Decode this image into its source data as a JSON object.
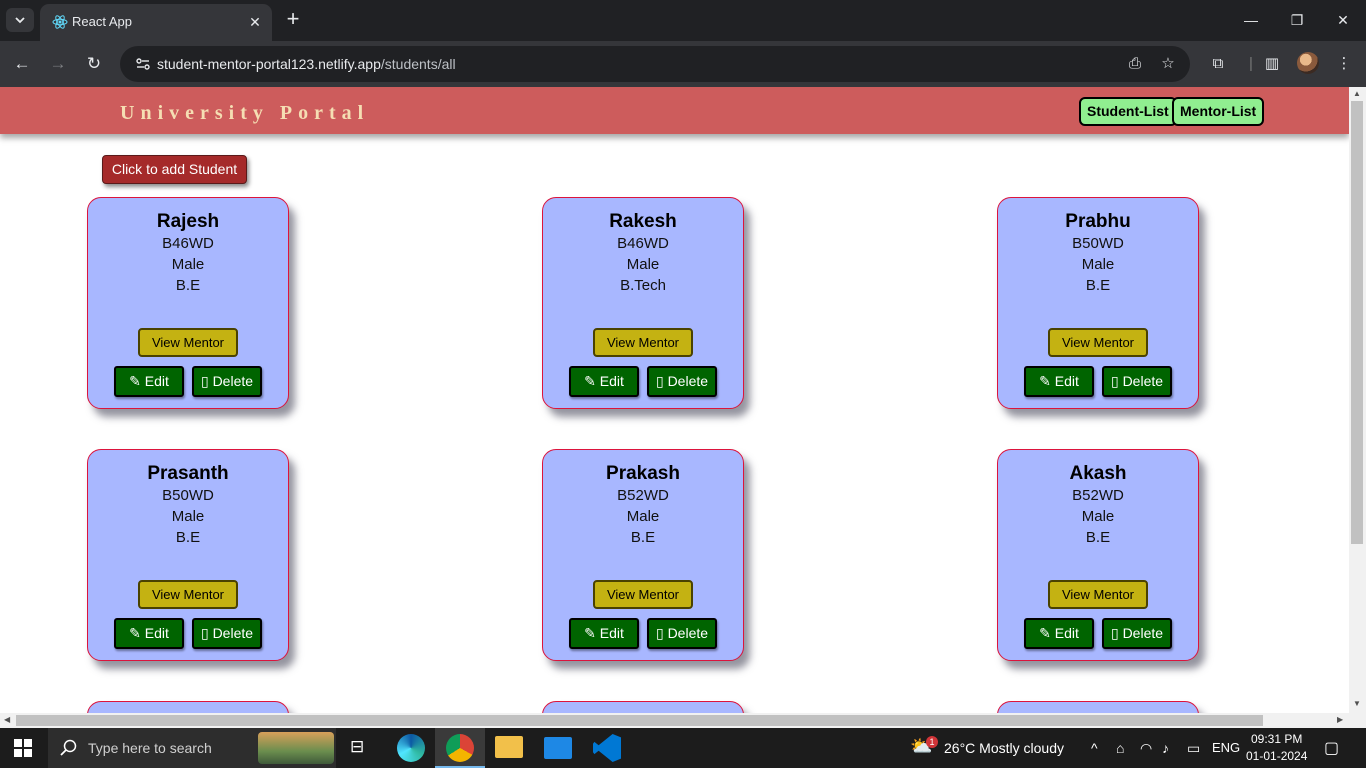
{
  "browser": {
    "tab_title": "React App",
    "url_host": "student-mentor-portal123.netlify.app",
    "url_path": "/students/all"
  },
  "app": {
    "brand": "University Portal",
    "nav": {
      "student_list": "Student-List",
      "mentor_list": "Mentor-List"
    },
    "add_button": "Click to add Student"
  },
  "card_labels": {
    "view_mentor": "View Mentor",
    "edit": "Edit",
    "delete": "Delete"
  },
  "students": [
    {
      "name": "Rajesh",
      "batch": "B46WD",
      "gender": "Male",
      "degree": "B.E"
    },
    {
      "name": "Rakesh",
      "batch": "B46WD",
      "gender": "Male",
      "degree": "B.Tech"
    },
    {
      "name": "Prabhu",
      "batch": "B50WD",
      "gender": "Male",
      "degree": "B.E"
    },
    {
      "name": "Prasanth",
      "batch": "B50WD",
      "gender": "Male",
      "degree": "B.E"
    },
    {
      "name": "Prakash",
      "batch": "B52WD",
      "gender": "Male",
      "degree": "B.E"
    },
    {
      "name": "Akash",
      "batch": "B52WD",
      "gender": "Male",
      "degree": "B.E"
    }
  ],
  "taskbar": {
    "search_placeholder": "Type here to search",
    "weather": "26°C  Mostly cloudy",
    "weather_badge": "1",
    "language": "ENG",
    "time": "09:31 PM",
    "date": "01-01-2024"
  }
}
